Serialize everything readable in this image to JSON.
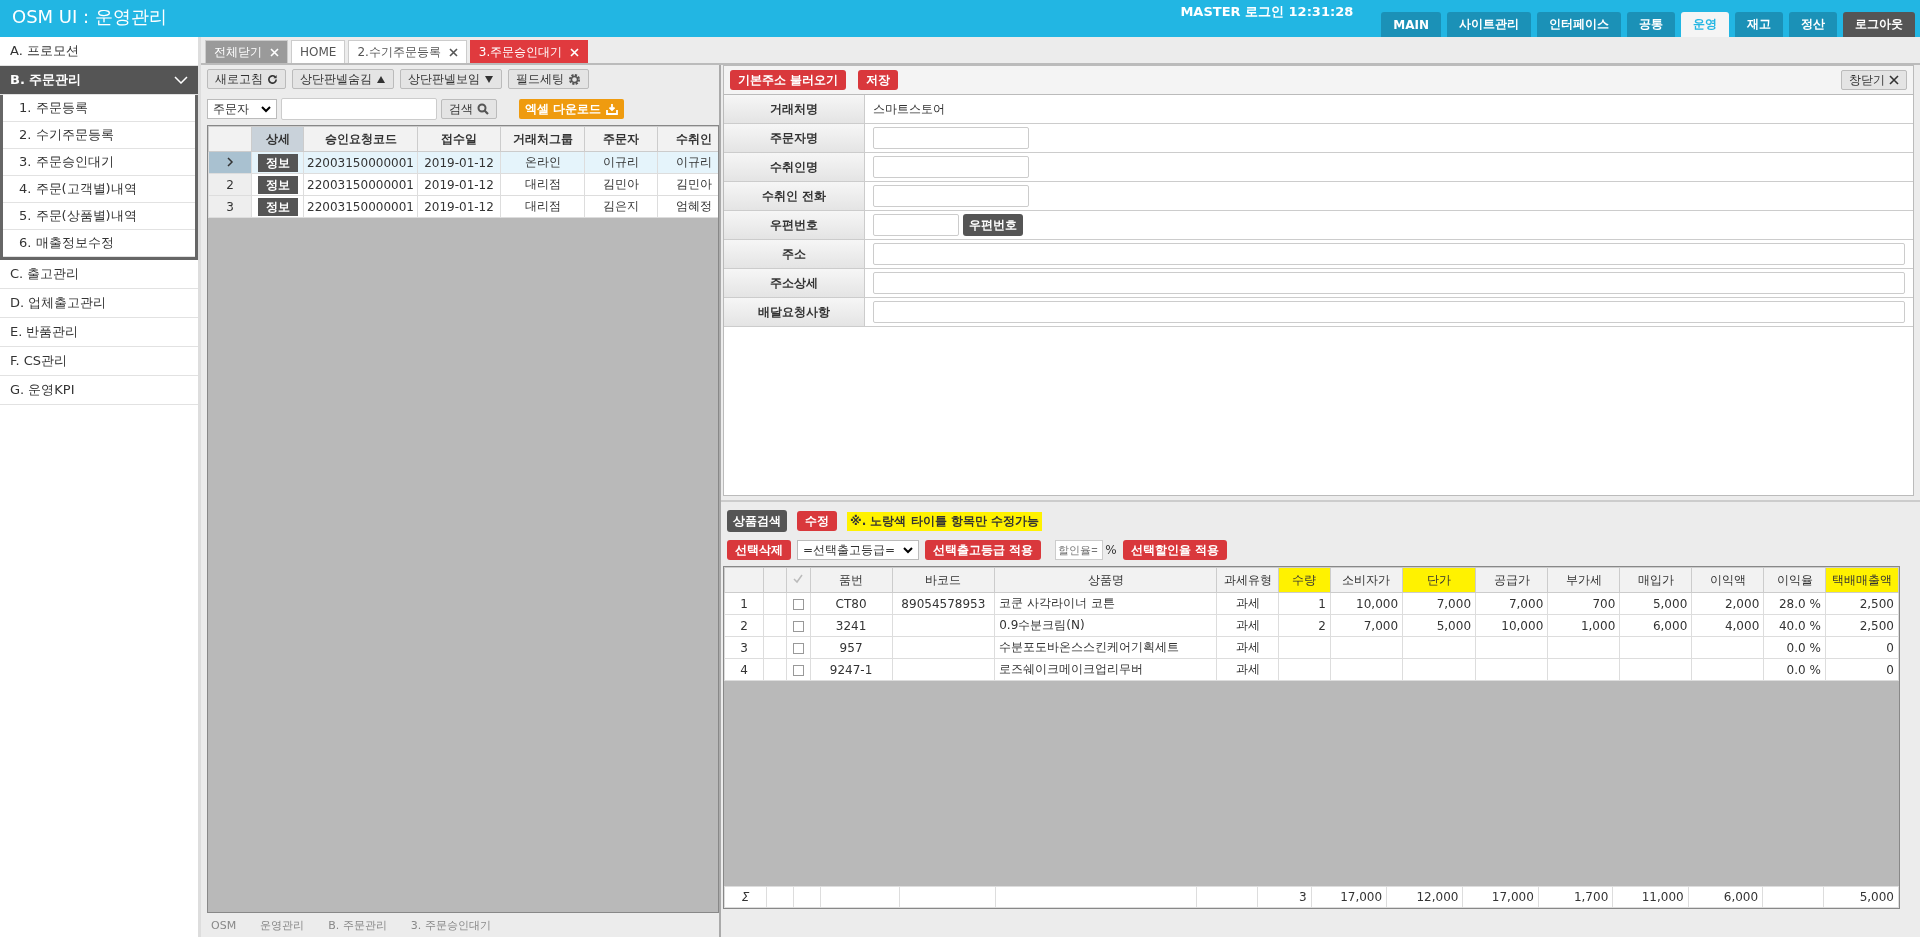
{
  "header": {
    "title": "OSM UI : 운영관리",
    "user_info": "MASTER 로그인 12:31:28",
    "nav": [
      {
        "label": "MAIN",
        "selected": false,
        "kind": "nav"
      },
      {
        "label": "사이트관리",
        "selected": false,
        "kind": "nav"
      },
      {
        "label": "인터페이스",
        "selected": false,
        "kind": "nav"
      },
      {
        "label": "공통",
        "selected": false,
        "kind": "nav"
      },
      {
        "label": "운영",
        "selected": true,
        "kind": "nav"
      },
      {
        "label": "재고",
        "selected": false,
        "kind": "nav"
      },
      {
        "label": "정산",
        "selected": false,
        "kind": "nav"
      },
      {
        "label": "로그아웃",
        "selected": false,
        "kind": "logout"
      }
    ]
  },
  "sidebar": {
    "items": [
      {
        "label": "A. 프로모션",
        "expanded": false
      },
      {
        "label": "B. 주문관리",
        "expanded": true,
        "children": [
          {
            "label": "1. 주문등록"
          },
          {
            "label": "2. 수기주문등록"
          },
          {
            "label": "3. 주문승인대기"
          },
          {
            "label": "4. 주문(고객별)내역"
          },
          {
            "label": "5. 주문(상품별)내역"
          },
          {
            "label": "6. 매출정보수정"
          }
        ]
      },
      {
        "label": "C. 출고관리",
        "expanded": false
      },
      {
        "label": "D. 업체출고관리",
        "expanded": false
      },
      {
        "label": "E. 반품관리",
        "expanded": false
      },
      {
        "label": "F. CS관리",
        "expanded": false
      },
      {
        "label": "G. 운영KPI",
        "expanded": false
      }
    ]
  },
  "tabs": [
    {
      "label": "전체닫기",
      "kind": "closeall",
      "selected": false,
      "closable": true
    },
    {
      "label": "HOME",
      "kind": "page",
      "selected": false,
      "closable": false
    },
    {
      "label": "2.수기주문등록",
      "kind": "page",
      "selected": false,
      "closable": true
    },
    {
      "label": "3.주문승인대기",
      "kind": "page",
      "selected": true,
      "closable": true
    }
  ],
  "left_panel": {
    "toolbar": [
      {
        "label": "새로고침",
        "kind": "refresh"
      },
      {
        "label": "상단판넬숨김",
        "kind": "up"
      },
      {
        "label": "상단판넬보임",
        "kind": "down"
      },
      {
        "label": "필드세팅",
        "kind": "gear"
      }
    ],
    "search": {
      "select": "주문자",
      "button": "검색",
      "excel": "엑셀 다운로드"
    },
    "table": {
      "columns": [
        "상세",
        "승인요청코드",
        "접수일",
        "거래처그룹",
        "주문자",
        "수취인"
      ],
      "rows": [
        {
          "selected": true,
          "cells": [
            "정보",
            "22003150000001",
            "2019-01-12",
            "온라인",
            "이규리",
            "이규리"
          ]
        },
        {
          "num": "2",
          "selected": false,
          "cells": [
            "정보",
            "22003150000001",
            "2019-01-12",
            "대리점",
            "김민아",
            "김민아"
          ]
        },
        {
          "num": "3",
          "selected": false,
          "cells": [
            "정보",
            "22003150000001",
            "2019-01-12",
            "대리점",
            "김은지",
            "엄혜정"
          ]
        }
      ]
    },
    "breadcrumb": [
      "OSM",
      "운영관리",
      "B. 주문관리",
      "3. 주문승인대기"
    ]
  },
  "right_panel": {
    "buttons": [
      "기본주소 불러오기",
      "저장"
    ],
    "close_button": "창닫기",
    "form": [
      {
        "label": "거래처명",
        "kind": "text",
        "value": "스마트스토어"
      },
      {
        "label": "주문자명",
        "kind": "input"
      },
      {
        "label": "수취인명",
        "kind": "input"
      },
      {
        "label": "수취인 전화",
        "kind": "input"
      },
      {
        "label": "우편번호",
        "kind": "zip",
        "button": "우편번호"
      },
      {
        "label": "주소",
        "kind": "wide"
      },
      {
        "label": "주소상세",
        "kind": "wide"
      },
      {
        "label": "배달요청사항",
        "kind": "wide"
      }
    ],
    "product_toolbar": {
      "search_button": "상품검색",
      "edit_button": "수정",
      "note": "※. 노랑색 타이틀 항목만 수정가능",
      "delete_button": "선택삭제",
      "grade_select": "=선택출고등급=",
      "grade_apply": "선택출고등급 적용",
      "discount_placeholder": "할인율=",
      "percent": "%",
      "discount_apply": "선택할인율 적용"
    },
    "products": {
      "columns": [
        {
          "label": "품번",
          "editable": false
        },
        {
          "label": "바코드",
          "editable": false
        },
        {
          "label": "상품명",
          "editable": false
        },
        {
          "label": "과세유형",
          "editable": false
        },
        {
          "label": "수량",
          "editable": true
        },
        {
          "label": "소비자가",
          "editable": false
        },
        {
          "label": "단가",
          "editable": true
        },
        {
          "label": "공급가",
          "editable": false
        },
        {
          "label": "부가세",
          "editable": false
        },
        {
          "label": "매입가",
          "editable": false
        },
        {
          "label": "이익액",
          "editable": false
        },
        {
          "label": "이익율",
          "editable": false
        },
        {
          "label": "택배매출액",
          "editable": true
        }
      ],
      "rows": [
        {
          "num": "1",
          "checked": false,
          "cells": [
            "CT80",
            "89054578953",
            "코쿤 사각라이너 코튼",
            "과세",
            "1",
            "10,000",
            "7,000",
            "7,000",
            "700",
            "5,000",
            "2,000",
            "28.0 %",
            "2,500"
          ]
        },
        {
          "num": "2",
          "checked": false,
          "cells": [
            "3241",
            "",
            "0.9수분크림(N)",
            "과세",
            "2",
            "7,000",
            "5,000",
            "10,000",
            "1,000",
            "6,000",
            "4,000",
            "40.0 %",
            "2,500"
          ]
        },
        {
          "num": "3",
          "checked": false,
          "cells": [
            "957",
            "",
            "수분포도바온스스킨케어기획세트",
            "과세",
            "",
            "",
            "",
            "",
            "",
            "",
            "",
            "0.0 %",
            "0"
          ]
        },
        {
          "num": "4",
          "checked": false,
          "cells": [
            "9247-1",
            "",
            "로즈쉐이크메이크업리무버",
            "과세",
            "",
            "",
            "",
            "",
            "",
            "",
            "",
            "0.0 %",
            "0"
          ]
        }
      ],
      "totals": {
        "symbol": "Σ",
        "quantity": "3",
        "consumer_price": "17,000",
        "unit_price": "12,000",
        "supply_price": "17,000",
        "vat": "1,700",
        "purchase_price": "11,000",
        "profit": "6,000",
        "delivery_sales": "5,000"
      }
    }
  }
}
